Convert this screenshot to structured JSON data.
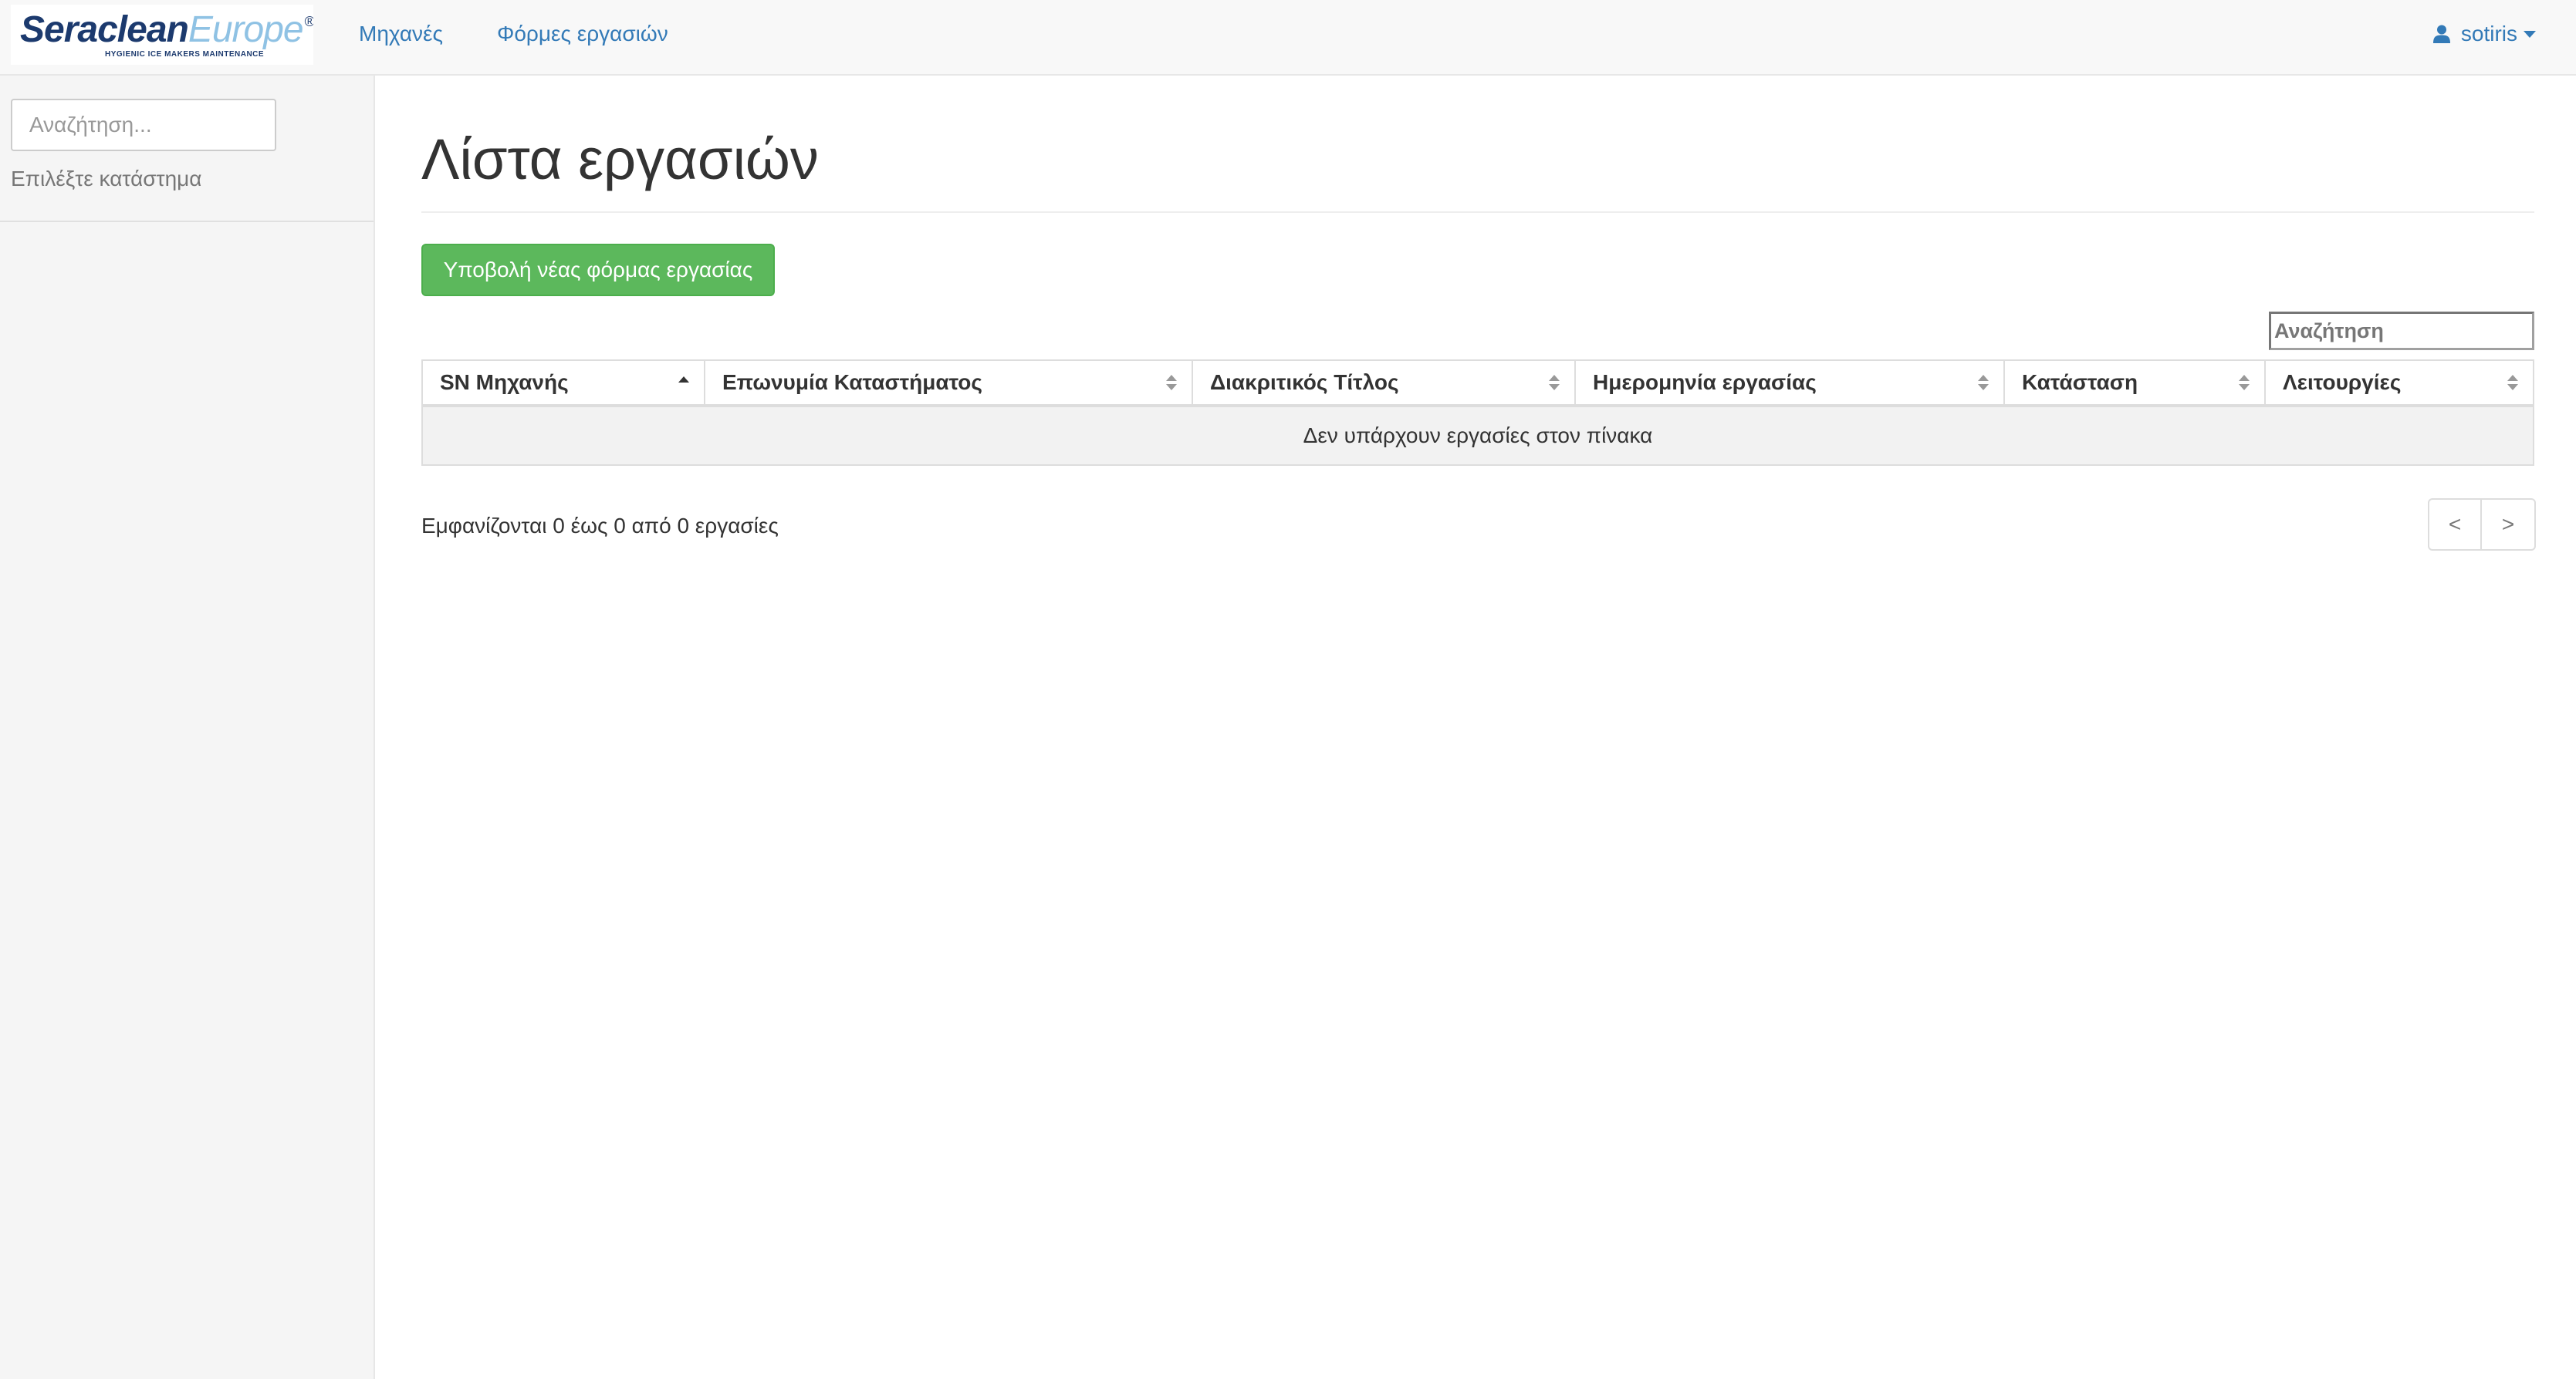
{
  "brand": {
    "name_part1": "Seraclean",
    "name_part2": "Europe",
    "registered": "®",
    "tagline": "HYGIENIC ICE MAKERS MAINTENANCE"
  },
  "navbar": {
    "links": [
      {
        "label": "Μηχανές"
      },
      {
        "label": "Φόρμες εργασιών"
      }
    ],
    "user": {
      "name": "sotiris",
      "icon": "user-icon"
    }
  },
  "sidebar": {
    "search_placeholder": "Αναζήτηση...",
    "hint": "Επιλέξτε κατάστημα"
  },
  "main": {
    "title": "Λίστα εργασιών",
    "new_button_label": "Υποβολή νέας φόρμας εργασίας",
    "new_button_color": "#5cb85c",
    "table_search_placeholder": "Αναζήτηση",
    "table": {
      "columns": [
        {
          "label": "SN Μηχανής",
          "sort": "ascending"
        },
        {
          "label": "Επωνυμία Καταστήματος",
          "sort": "none"
        },
        {
          "label": "Διακριτικός Τίτλος",
          "sort": "none"
        },
        {
          "label": "Ημερομηνία εργασίας",
          "sort": "none"
        },
        {
          "label": "Κατάσταση",
          "sort": "none"
        },
        {
          "label": "Λειτουργίες",
          "sort": "none"
        }
      ],
      "empty_message": "Δεν υπάρχουν εργασίες στον πίνακα"
    },
    "info_text": "Εμφανίζονται 0 έως 0 από 0 εργασίες",
    "pagination": {
      "prev": "<",
      "next": ">"
    }
  },
  "colors": {
    "link": "#337ab7",
    "navbar_bg": "#f8f8f8",
    "sidebar_bg": "#f5f5f5"
  }
}
